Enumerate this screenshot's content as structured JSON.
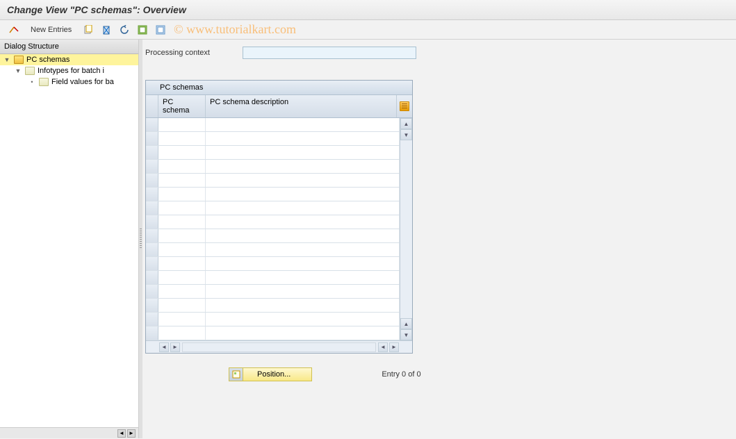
{
  "title": "Change View \"PC schemas\": Overview",
  "watermark": "© www.tutorialkart.com",
  "toolbar": {
    "new_entries": "New Entries"
  },
  "dialog_structure": {
    "header": "Dialog Structure",
    "items": [
      {
        "label": "PC schemas",
        "selected": true,
        "open": true,
        "level": 0
      },
      {
        "label": "Infotypes for batch i",
        "selected": false,
        "open": false,
        "level": 1
      },
      {
        "label": "Field values for ba",
        "selected": false,
        "open": false,
        "level": 2
      }
    ]
  },
  "context": {
    "label": "Processing context",
    "value": ""
  },
  "table": {
    "title": "PC schemas",
    "columns": [
      "PC schema",
      "PC schema description"
    ],
    "rows": [
      [
        "",
        ""
      ],
      [
        "",
        ""
      ],
      [
        "",
        ""
      ],
      [
        "",
        ""
      ],
      [
        "",
        ""
      ],
      [
        "",
        ""
      ],
      [
        "",
        ""
      ],
      [
        "",
        ""
      ],
      [
        "",
        ""
      ],
      [
        "",
        ""
      ],
      [
        "",
        ""
      ],
      [
        "",
        ""
      ],
      [
        "",
        ""
      ],
      [
        "",
        ""
      ],
      [
        "",
        ""
      ],
      [
        "",
        ""
      ]
    ]
  },
  "footer": {
    "position_label": "Position...",
    "entry_text": "Entry 0 of 0"
  }
}
